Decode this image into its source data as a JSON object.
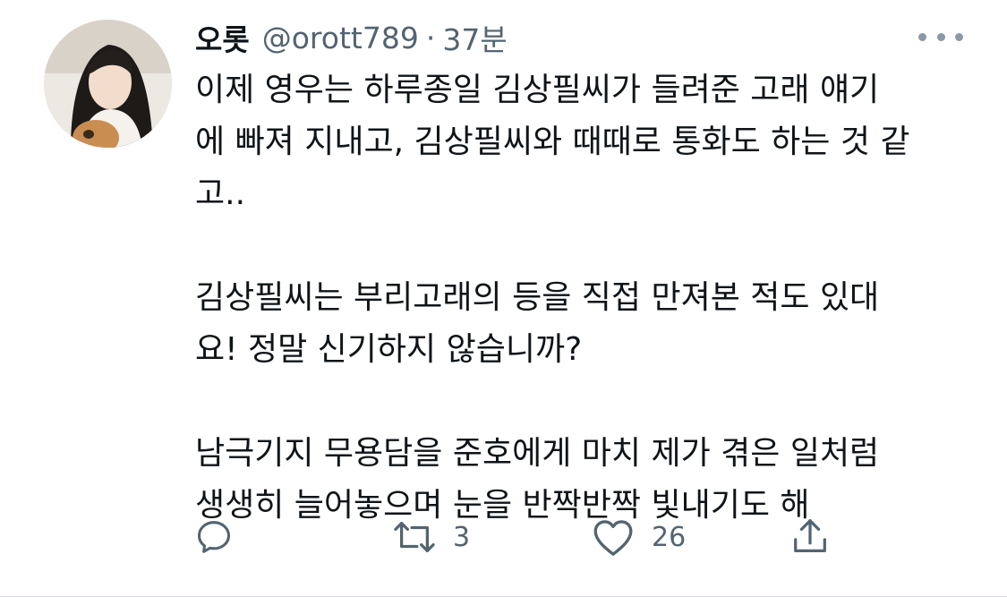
{
  "tweet": {
    "author": {
      "display_name": "오롯",
      "handle": "@orott789",
      "separator": "·",
      "time": "37분"
    },
    "paragraphs": [
      [
        "이제 영우는 하루종일 김상필씨가 들려준 고래 얘기",
        "에 빠져 지내고, 김상필씨와 때때로 통화도 하는 것 같",
        "고.."
      ],
      [
        "김상필씨는 부리고래의 등을 직접 만져본 적도 있대",
        "요! 정말 신기하지 않습니까?"
      ],
      [
        "남극기지 무용담을 준호에게 마치 제가 겪은 일처럼",
        "생생히 늘어놓으며 눈을 반짝반짝 빛내기도 해"
      ]
    ],
    "actions": {
      "reply_count": "",
      "retweet_count": "3",
      "like_count": "26"
    }
  },
  "icons": {
    "more": "more-horizontal-icon",
    "reply": "reply-icon",
    "retweet": "retweet-icon",
    "like": "heart-icon",
    "share": "share-icon"
  },
  "colors": {
    "text": "#0f1419",
    "secondary": "#536471",
    "icon": "#536471",
    "divider": "#d9dde1"
  }
}
